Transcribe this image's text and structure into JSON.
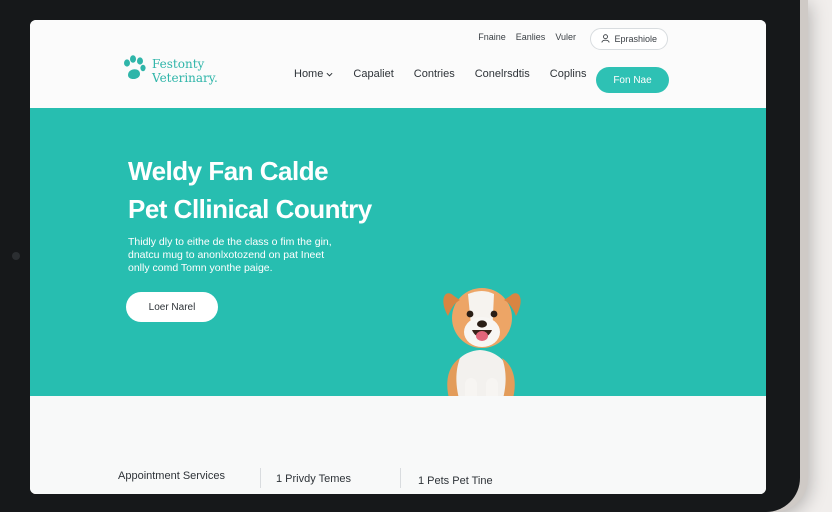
{
  "header": {
    "logo": {
      "line1": "Festonty",
      "line2": "Veterinary."
    },
    "top_links": [
      "Fnaine",
      "Eanlies",
      "Vuler"
    ],
    "signin_label": "Eprashiole",
    "nav": [
      "Home",
      "Capaliet",
      "Contries",
      "Conelrsdtis",
      "Coplins"
    ],
    "nav_dropdown_icon": "chevron-down-icon",
    "cta_label": "Fon Nae"
  },
  "hero": {
    "title_line1": "Weldy Fan Calde",
    "title_line2": "Pet Cllinical Country",
    "text_line1": "Thidly dly to eithe de the class o fim the gin,",
    "text_line2": "dnatcu mug to anonlxotozend on pat Ineet",
    "text_line3": "onlly comd Tomn yonthe paige.",
    "button_label": "Loer Narel"
  },
  "services": {
    "items": [
      "Appointment Services",
      "1 Privdy Temes",
      "1 Pets Pet Tine"
    ]
  },
  "colors": {
    "brand": "#27beb0",
    "button": "#2ec1b4"
  }
}
